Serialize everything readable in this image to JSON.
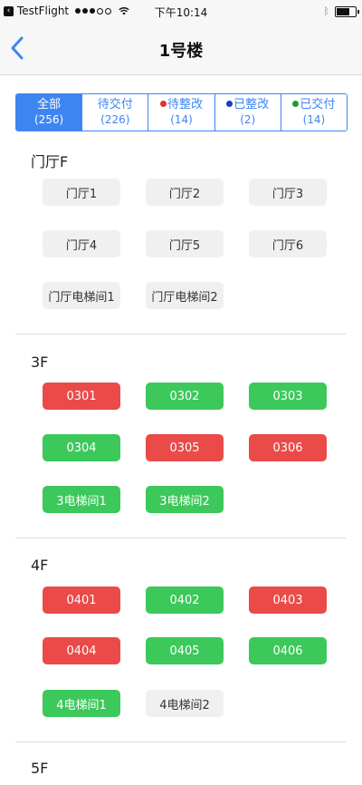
{
  "status_bar": {
    "app_name": "TestFlight",
    "time": "下午10:14",
    "battery_level": 0.7
  },
  "nav": {
    "title": "1号楼",
    "back_icon": "chevron-left-icon"
  },
  "filters": [
    {
      "label": "全部",
      "count": "(256)",
      "active": true,
      "marker_color": ""
    },
    {
      "label": "待交付",
      "count": "(226)",
      "active": false,
      "marker_color": ""
    },
    {
      "label": "待整改",
      "count": "(14)",
      "active": false,
      "marker_color": "#e03131"
    },
    {
      "label": "已整改",
      "count": "(2)",
      "active": false,
      "marker_color": "#1a3cc8"
    },
    {
      "label": "已交付",
      "count": "(14)",
      "active": false,
      "marker_color": "#1f9a2a"
    }
  ],
  "colors": {
    "accent": "#3d86f2",
    "red": "#ea4a48",
    "green": "#3cc85a",
    "gray": "#f0f0f0"
  },
  "sections": [
    {
      "title": "门厅F",
      "rooms": [
        {
          "label": "门厅1",
          "status": "gray"
        },
        {
          "label": "门厅2",
          "status": "gray"
        },
        {
          "label": "门厅3",
          "status": "gray"
        },
        {
          "label": "门厅4",
          "status": "gray"
        },
        {
          "label": "门厅5",
          "status": "gray"
        },
        {
          "label": "门厅6",
          "status": "gray"
        },
        {
          "label": "门厅电梯间1",
          "status": "gray"
        },
        {
          "label": "门厅电梯间2",
          "status": "gray"
        }
      ]
    },
    {
      "title": "3F",
      "rooms": [
        {
          "label": "0301",
          "status": "red"
        },
        {
          "label": "0302",
          "status": "green"
        },
        {
          "label": "0303",
          "status": "green"
        },
        {
          "label": "0304",
          "status": "green"
        },
        {
          "label": "0305",
          "status": "red"
        },
        {
          "label": "0306",
          "status": "red"
        },
        {
          "label": "3电梯间1",
          "status": "green"
        },
        {
          "label": "3电梯间2",
          "status": "green"
        }
      ]
    },
    {
      "title": "4F",
      "rooms": [
        {
          "label": "0401",
          "status": "red"
        },
        {
          "label": "0402",
          "status": "green"
        },
        {
          "label": "0403",
          "status": "red"
        },
        {
          "label": "0404",
          "status": "red"
        },
        {
          "label": "0405",
          "status": "green"
        },
        {
          "label": "0406",
          "status": "green"
        },
        {
          "label": "4电梯间1",
          "status": "green"
        },
        {
          "label": "4电梯间2",
          "status": "gray"
        }
      ]
    },
    {
      "title": "5F",
      "rooms": []
    }
  ]
}
